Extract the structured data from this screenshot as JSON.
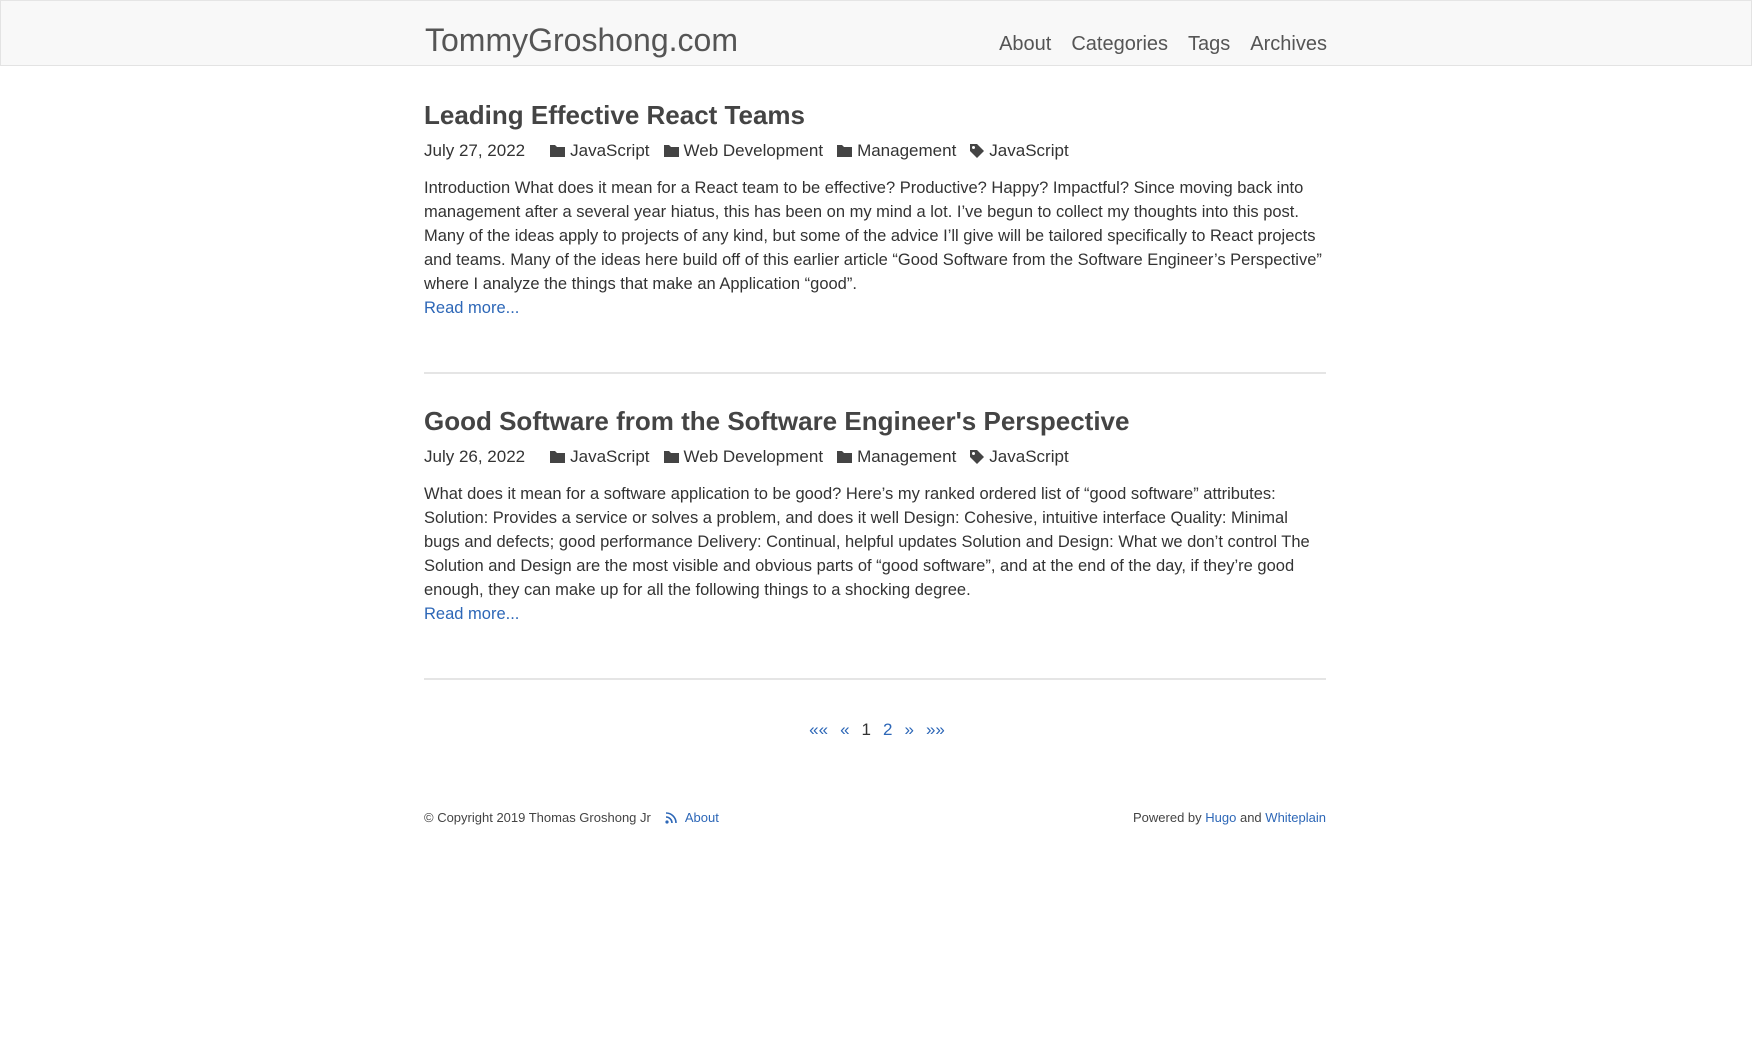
{
  "site": {
    "brand": "TommyGroshong.com",
    "nav": [
      "About",
      "Categories",
      "Tags",
      "Archives"
    ]
  },
  "posts": [
    {
      "title": "Leading Effective React Teams",
      "date": "July 27, 2022",
      "categories": [
        "JavaScript",
        "Web Development",
        "Management"
      ],
      "tags": [
        "JavaScript"
      ],
      "summary": "Introduction What does it mean for a React team to be effective? Productive? Happy? Impactful? Since moving back into management after a several year hiatus, this has been on my mind a lot. I’ve begun to collect my thoughts into this post. Many of the ideas apply to projects of any kind, but some of the advice I’ll give will be tailored specifically to React projects and teams. Many of the ideas here build off of this earlier article “Good Software from the Software Engineer’s Perspective” where I analyze the things that make an Application “good”.",
      "read_more": "Read more..."
    },
    {
      "title": "Good Software from the Software Engineer's Perspective",
      "date": "July 26, 2022",
      "categories": [
        "JavaScript",
        "Web Development",
        "Management"
      ],
      "tags": [
        "JavaScript"
      ],
      "summary": "What does it mean for a software application to be good? Here’s my ranked ordered list of “good software” attributes: Solution: Provides a service or solves a problem, and does it well Design: Cohesive, intuitive interface Quality: Minimal bugs and defects; good performance Delivery: Continual, helpful updates Solution and Design: What we don’t control The Solution and Design are the most visible and obvious parts of “good software”, and at the end of the day, if they’re good enough, they can make up for all the following things to a shocking degree.",
      "read_more": "Read more..."
    }
  ],
  "pagination": {
    "first": "««",
    "prev": "«",
    "current": "1",
    "next_page": "2",
    "next": "»",
    "last": "»»"
  },
  "footer": {
    "copyright": "© Copyright 2019 Thomas Groshong Jr",
    "about": "About",
    "powered_by": "Powered by",
    "hugo": "Hugo",
    "and": "and",
    "theme": "Whiteplain"
  },
  "colors": {
    "link": "#2d67b7",
    "text": "#333333",
    "nav_bg": "#f8f8f8"
  },
  "icons": {
    "category": "folder-icon",
    "tag": "tag-icon",
    "feed": "rss-icon"
  }
}
